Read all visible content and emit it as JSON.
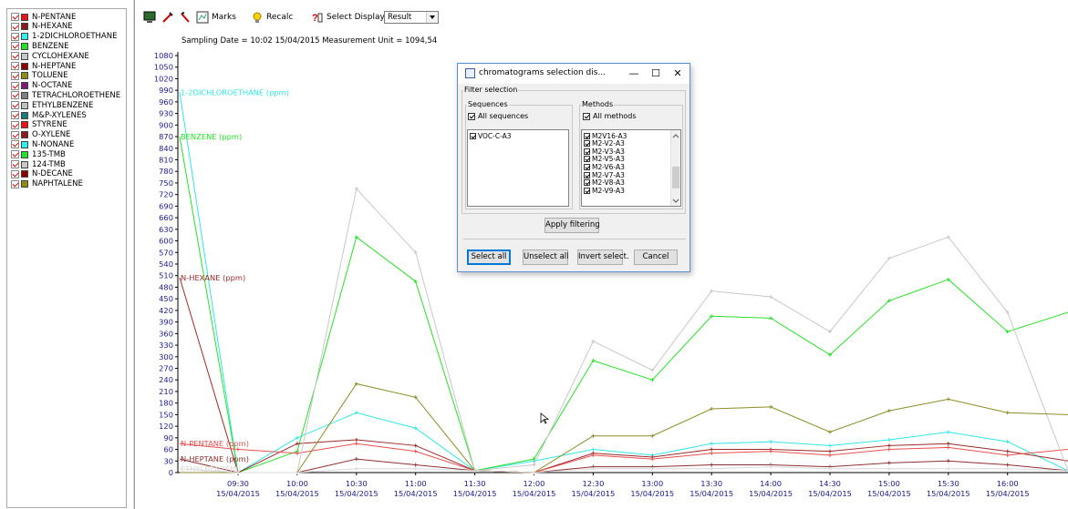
{
  "legend": {
    "items": [
      {
        "label": "N-PENTANE",
        "color": "#e8141b"
      },
      {
        "label": "N-HEXANE",
        "color": "#8b1a1a"
      },
      {
        "label": "1-2DICHLOROETHANE",
        "color": "#32f0f0"
      },
      {
        "label": "BENZENE",
        "color": "#28e028"
      },
      {
        "label": "CYCLOHEXANE",
        "color": "#c8c8c8"
      },
      {
        "label": "N-HEPTANE",
        "color": "#8b0000"
      },
      {
        "label": "TOLUENE",
        "color": "#8c8c14"
      },
      {
        "label": "N-OCTANE",
        "color": "#7a1a7a"
      },
      {
        "label": "TETRACHLOROETHENE",
        "color": "#808080"
      },
      {
        "label": "ETHYLBENZENE",
        "color": "#c0c0c0"
      },
      {
        "label": "M&P-XYLENES",
        "color": "#207878"
      },
      {
        "label": "STYRENE",
        "color": "#e8141b"
      },
      {
        "label": "O-XYLENE",
        "color": "#8b1a1a"
      },
      {
        "label": "N-NONANE",
        "color": "#32f0f0"
      },
      {
        "label": "135-TMB",
        "color": "#28e028"
      },
      {
        "label": "124-TMB",
        "color": "#c8c8c8"
      },
      {
        "label": "N-DECANE",
        "color": "#8b0000"
      },
      {
        "label": "NAPHTALENE",
        "color": "#8c8c14"
      }
    ]
  },
  "toolbar": {
    "marks_label": "Marks",
    "recalc_label": "Recalc",
    "select_display_label": "Select Display",
    "display_value": "Result"
  },
  "header": {
    "sampling_text": "Sampling Date = 10:02 15/04/2015   Measurement Unit = 1094,54"
  },
  "chart_data": {
    "type": "line",
    "x": [
      "09:30 15/04/2015",
      "10:00 15/04/2015",
      "10:30 15/04/2015",
      "11:00 15/04/2015",
      "11:30 15/04/2015",
      "12:00 15/04/2015",
      "12:30 15/04/2015",
      "13:00 15/04/2015",
      "13:30 15/04/2015",
      "14:00 15/04/2015",
      "14:30 15/04/2015",
      "15:00 15/04/2015",
      "15:30 15/04/2015",
      "16:00 15/04/2015"
    ],
    "x_ticks": [
      {
        "time": "09:30",
        "date": "15/04/2015"
      },
      {
        "time": "10:00",
        "date": "15/04/2015"
      },
      {
        "time": "10:30",
        "date": "15/04/2015"
      },
      {
        "time": "11:00",
        "date": "15/04/2015"
      },
      {
        "time": "11:30",
        "date": "15/04/2015"
      },
      {
        "time": "12:00",
        "date": "15/04/2015"
      },
      {
        "time": "12:30",
        "date": "15/04/2015"
      },
      {
        "time": "13:00",
        "date": "15/04/2015"
      },
      {
        "time": "13:30",
        "date": "15/04/2015"
      },
      {
        "time": "14:00",
        "date": "15/04/2015"
      },
      {
        "time": "14:30",
        "date": "15/04/2015"
      },
      {
        "time": "15:00",
        "date": "15/04/2015"
      },
      {
        "time": "15:30",
        "date": "15/04/2015"
      },
      {
        "time": "16:00",
        "date": "15/04/2015"
      }
    ],
    "y_ticks": [
      0,
      30,
      60,
      90,
      120,
      150,
      180,
      210,
      240,
      270,
      300,
      330,
      360,
      390,
      420,
      450,
      480,
      510,
      540,
      570,
      600,
      630,
      660,
      690,
      720,
      750,
      780,
      810,
      840,
      870,
      900,
      930,
      960,
      990,
      1020,
      1050,
      1080
    ],
    "ylim": [
      0,
      1080
    ],
    "series": [
      {
        "name": "1-2DICHLOROETHANE (ppm)",
        "color": "#32e6e6",
        "start": 985,
        "values": [
          0,
          90,
          155,
          115,
          5,
          30,
          60,
          45,
          75,
          80,
          70,
          85,
          105,
          80
        ],
        "end": 5
      },
      {
        "name": "BENZENE (ppm)",
        "color": "#28e028",
        "start": 870,
        "values": [
          0,
          55,
          610,
          495,
          5,
          35,
          290,
          240,
          405,
          400,
          305,
          445,
          500,
          365
        ],
        "end": 415
      },
      {
        "name": "N-HEXANE (ppm)",
        "color": "#9b2a2a",
        "start": 505,
        "values": [
          0,
          75,
          85,
          70,
          5,
          0,
          50,
          40,
          60,
          60,
          55,
          70,
          75,
          55
        ],
        "end": 30
      },
      {
        "name": "N-PENTANE (ppm)",
        "color": "#e85050",
        "start": 75,
        "values": [
          60,
          50,
          75,
          55,
          5,
          0,
          45,
          35,
          50,
          55,
          45,
          60,
          65,
          45
        ],
        "end": 60
      },
      {
        "name": "N-HEPTANE (ppm)",
        "color": "#8b3030",
        "start": 35,
        "values": [
          0,
          0,
          35,
          20,
          5,
          0,
          15,
          15,
          20,
          20,
          15,
          25,
          30,
          20
        ],
        "end": 5
      },
      {
        "name": "",
        "color": "#c8c8c8",
        "start": 0,
        "values": [
          0,
          0,
          735,
          570,
          5,
          20,
          340,
          265,
          470,
          455,
          365,
          555,
          610,
          415
        ],
        "end": 5
      },
      {
        "name": "",
        "color": "#8c8c28",
        "start": 0,
        "values": [
          0,
          0,
          230,
          195,
          5,
          0,
          95,
          95,
          165,
          170,
          105,
          160,
          190,
          155
        ],
        "end": 150
      },
      {
        "name": "ETHYLBENZENE",
        "color": "#d8d8d8",
        "start": 10,
        "values": [
          0,
          0,
          10,
          10,
          5,
          0,
          10,
          10,
          10,
          15,
          10,
          10,
          10,
          10
        ],
        "end": 5
      }
    ],
    "series_labels": [
      "1-2DICHLOROETHANE (ppm)",
      "BENZENE (ppm)",
      "N-HEXANE (ppm)",
      "N-PENTANE (ppm)",
      "N-HEPTANE (ppm)",
      "ETHYLBENZENE"
    ]
  },
  "dialog": {
    "title": "chromatograms selection dis...",
    "filter_label": "Filter selection",
    "sequences_label": "Sequences",
    "all_sequences_label": "All sequences",
    "methods_label": "Methods",
    "all_methods_label": "All methods",
    "sequences": [
      "VOC-C-A3"
    ],
    "methods": [
      "M2V16-A3",
      "M2-V2-A3",
      "M2-V3-A3",
      "M2-V5-A3",
      "M2-V6-A3",
      "M2-V7-A3",
      "M2-V8-A3",
      "M2-V9-A3"
    ],
    "apply_label": "Apply filtering",
    "select_all_label": "Select all",
    "unselect_all_label": "Unselect all",
    "invert_label": "Invert select.",
    "cancel_label": "Cancel"
  }
}
